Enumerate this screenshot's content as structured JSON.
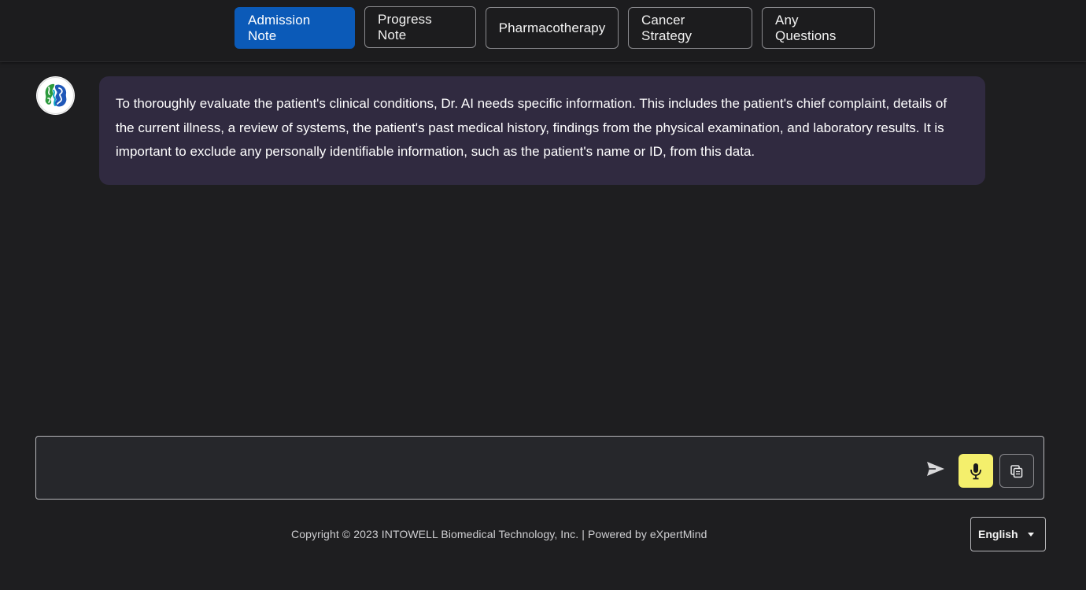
{
  "tabs": [
    {
      "label": "Admission Note",
      "active": true
    },
    {
      "label": "Progress Note",
      "active": false
    },
    {
      "label": "Pharmacotherapy",
      "active": false
    },
    {
      "label": "Cancer Strategy",
      "active": false
    },
    {
      "label": "Any Questions",
      "active": false
    }
  ],
  "chat": {
    "assistant_avatar_icon": "brain-logo-icon",
    "messages": [
      {
        "role": "assistant",
        "text": "To thoroughly evaluate the patient's clinical conditions, Dr. AI needs specific information. This includes the patient's chief complaint, details of the current illness, a review of systems, the patient's past medical history, findings from the physical examination, and laboratory results. It is important to exclude any personally identifiable information, such as the patient's name or ID, from this data."
      }
    ]
  },
  "composer": {
    "value": "",
    "placeholder": "",
    "send_icon": "send-icon",
    "mic_icon": "microphone-icon",
    "copy_icon": "copy-icon"
  },
  "footer": {
    "text": "Copyright © 2023 INTOWELL Biomedical Technology, Inc. | Powered by eXpertMind"
  },
  "language": {
    "selected": "English"
  },
  "colors": {
    "background": "#1e1e20",
    "active_tab": "#0b5ab8",
    "bubble": "#302a40",
    "mic_button": "#f4ef6c"
  }
}
